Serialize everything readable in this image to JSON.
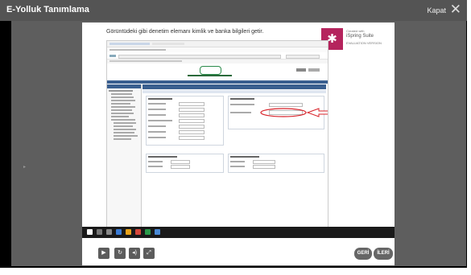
{
  "window": {
    "title": "E-Yolluk Tanımlama",
    "close_label": "Kapat",
    "close_icon": "close-icon"
  },
  "slide": {
    "heading": "Görüntüdeki gibi denetim elemanı kimlik ve banka bilgileri getir.",
    "logo": {
      "line1": "Created with",
      "line2": "iSpring Suite",
      "line3": "EVALUATION VERSION"
    }
  },
  "player": {
    "back_label": "GERİ",
    "next_label": "İLERİ"
  }
}
